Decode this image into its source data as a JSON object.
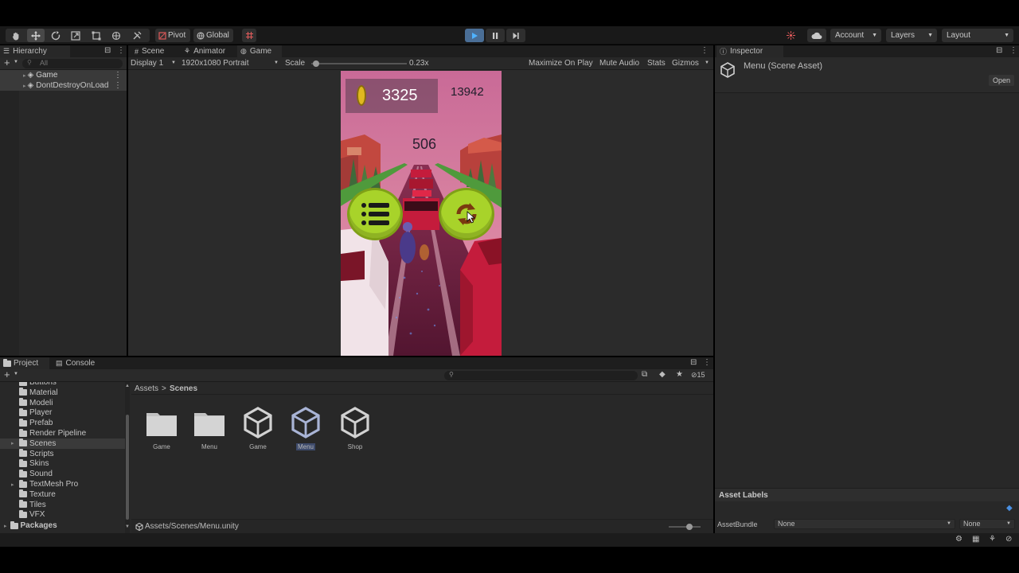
{
  "toolbar": {
    "pivot_label": "Pivot",
    "global_label": "Global",
    "account_label": "Account",
    "layers_label": "Layers",
    "layout_label": "Layout"
  },
  "hierarchy": {
    "tab_label": "Hierarchy",
    "search_placeholder": "All",
    "items": [
      {
        "label": "Game"
      },
      {
        "label": "DontDestroyOnLoad"
      }
    ]
  },
  "game_view": {
    "tabs": [
      {
        "label": "Scene"
      },
      {
        "label": "Animator"
      },
      {
        "label": "Game"
      }
    ],
    "display_label": "Display 1",
    "resolution_label": "1920x1080 Portrait",
    "scale_label": "Scale",
    "scale_value": "0.23x",
    "scale_fraction": 0.05,
    "maximize_label": "Maximize On Play",
    "mute_label": "Mute Audio",
    "stats_label": "Stats",
    "gizmos_label": "Gizmos"
  },
  "game_screen": {
    "coins": "3325",
    "best_score": "13942",
    "current_score": "506",
    "colors": {
      "sky": "#d8789e",
      "button_green": "#a8d32a",
      "road": "#5a1c36",
      "car_red": "#c41c3c"
    }
  },
  "inspector": {
    "tab_label": "Inspector",
    "title": "Menu (Scene Asset)",
    "open_button": "Open",
    "asset_labels_title": "Asset Labels",
    "assetbundle_label": "AssetBundle",
    "assetbundle_value": "None",
    "variant_value": "None"
  },
  "project": {
    "tabs": [
      {
        "label": "Project"
      },
      {
        "label": "Console"
      }
    ],
    "tree": [
      {
        "label": "Buttons"
      },
      {
        "label": "Material"
      },
      {
        "label": "Modeli"
      },
      {
        "label": "Player"
      },
      {
        "label": "Prefab"
      },
      {
        "label": "Render Pipeline"
      },
      {
        "label": "Scenes"
      },
      {
        "label": "Scripts"
      },
      {
        "label": "Skins"
      },
      {
        "label": "Sound"
      },
      {
        "label": "TextMesh Pro"
      },
      {
        "label": "Texture"
      },
      {
        "label": "Tiles"
      },
      {
        "label": "VFX"
      }
    ],
    "packages_label": "Packages",
    "breadcrumb": [
      {
        "label": "Assets"
      },
      {
        "label": "Scenes"
      }
    ],
    "assets": [
      {
        "label": "Game",
        "kind": "folder-icon"
      },
      {
        "label": "Menu",
        "kind": "folder-icon"
      },
      {
        "label": "Game",
        "kind": "unity-scene-icon"
      },
      {
        "label": "Menu",
        "kind": "unity-scene-icon"
      },
      {
        "label": "Shop",
        "kind": "unity-scene-icon"
      }
    ],
    "hidden_count": "15",
    "path": "Assets/Scenes/Menu.unity"
  }
}
